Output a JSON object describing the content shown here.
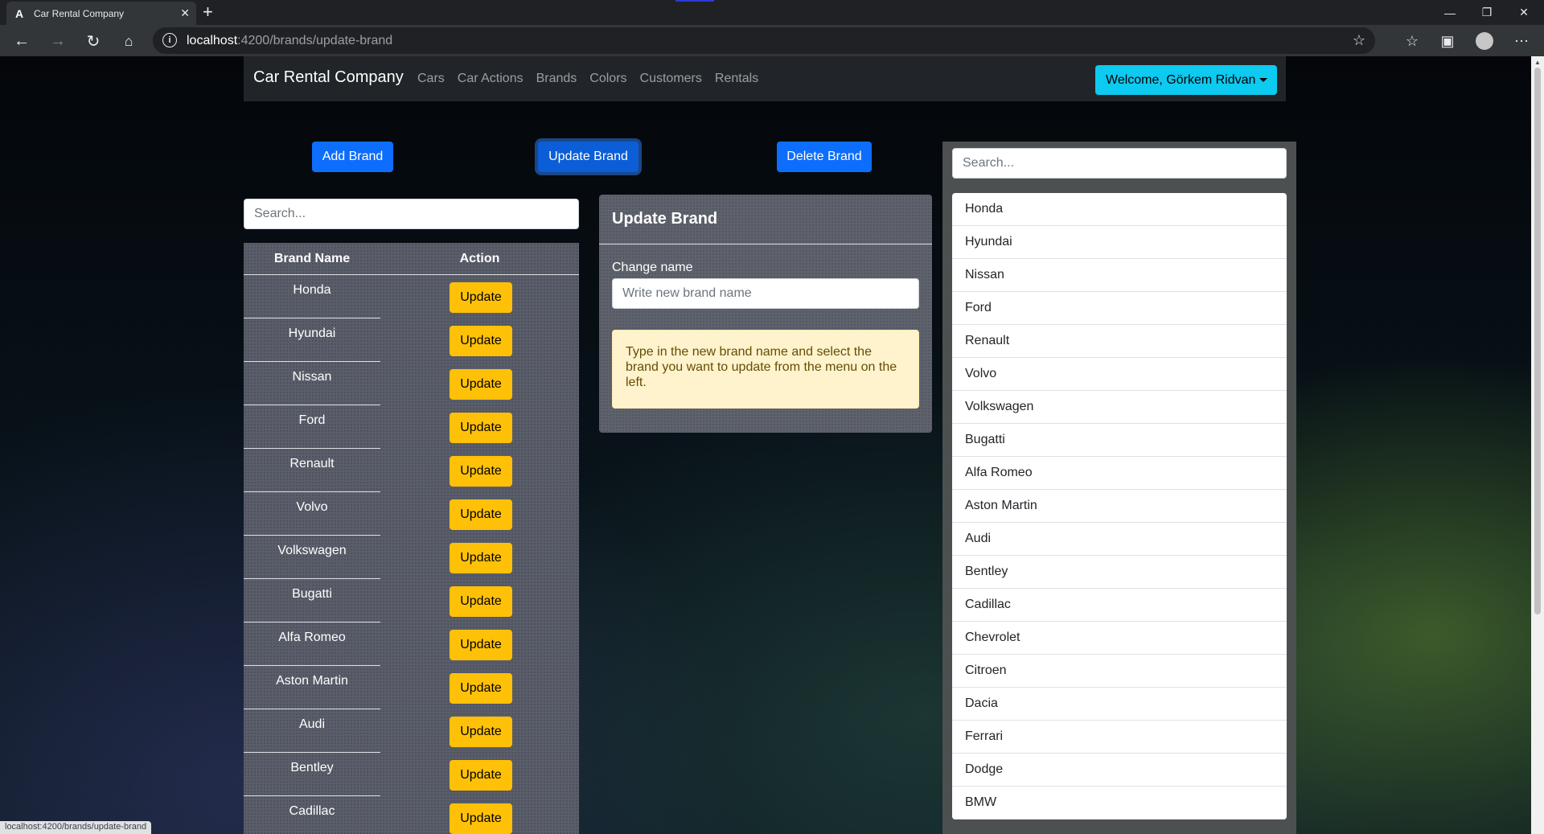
{
  "browser": {
    "tab_title": "Car Rental Company",
    "favicon": "A",
    "url_host": "localhost",
    "url_path": ":4200/brands/update-brand",
    "status_url": "localhost:4200/brands/update-brand"
  },
  "navbar": {
    "brand": "Car Rental Company",
    "links": [
      "Cars",
      "Car Actions",
      "Brands",
      "Colors",
      "Customers",
      "Rentals"
    ],
    "welcome": "Welcome, Görkem Ridvan"
  },
  "actions": {
    "add": "Add Brand",
    "update": "Update Brand",
    "delete": "Delete Brand"
  },
  "left": {
    "search_placeholder": "Search...",
    "col_name": "Brand Name",
    "col_action": "Action",
    "button_label": "Update",
    "rows": [
      "Honda",
      "Hyundai",
      "Nissan",
      "Ford",
      "Renault",
      "Volvo",
      "Volkswagen",
      "Bugatti",
      "Alfa Romeo",
      "Aston Martin",
      "Audi",
      "Bentley",
      "Cadillac"
    ]
  },
  "card": {
    "title": "Update Brand",
    "label": "Change name",
    "placeholder": "Write new brand name",
    "alert": "Type in the new brand name and select the brand you want to update from the menu on the left."
  },
  "right": {
    "search_placeholder": "Search...",
    "items": [
      "Honda",
      "Hyundai",
      "Nissan",
      "Ford",
      "Renault",
      "Volvo",
      "Volkswagen",
      "Bugatti",
      "Alfa Romeo",
      "Aston Martin",
      "Audi",
      "Bentley",
      "Cadillac",
      "Chevrolet",
      "Citroen",
      "Dacia",
      "Ferrari",
      "Dodge",
      "BMW"
    ]
  },
  "colors": {
    "primary": "#0d6efd",
    "warning": "#ffc107",
    "info": "#0dcaf0",
    "navbar": "#212529"
  }
}
